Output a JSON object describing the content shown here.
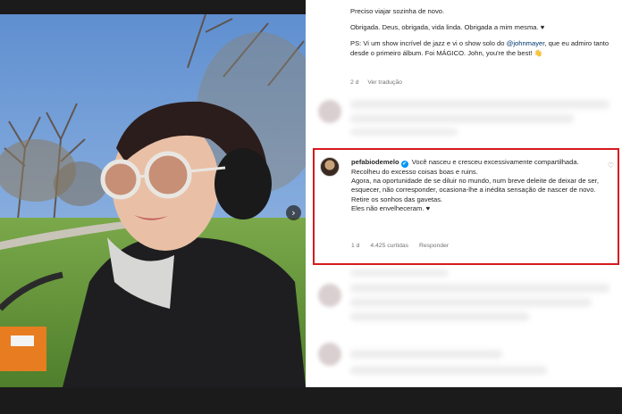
{
  "caption": {
    "line1": "Preciso viajar sozinha de novo.",
    "line2": "Obrigada. Deus, obrigada, vida linda. Obrigada a mim mesma. ♥",
    "line3_prefix": "PS: Vi um show incrível de jazz e vi o show solo do ",
    "mention": "@johnmayer",
    "line3_suffix": ", que eu admiro tanto desde o primeiro álbum. Foi MÁGICO. John, you're the best! 👋"
  },
  "caption_meta": {
    "age": "2 d",
    "translate": "Ver tradução"
  },
  "highlighted_comment": {
    "username": "pefabiodemelo",
    "verified_mark": "✔",
    "text_line1": "Você nasceu e cresceu excessivamente compartilhada.",
    "text_line2": "Recolheu do excesso coisas boas e ruins.",
    "text_line3": "Agora, na oportunidade de se diluir no mundo, num breve deleite de deixar de ser, esquecer, não corresponder, ocasiona-lhe a inédita sensação de nascer de novo.",
    "text_line4": "Retire os sonhos das gavetas.",
    "text_line5": "Eles não envelheceram. ♥",
    "age": "1 d",
    "likes": "4.425 curtidas",
    "reply": "Responder",
    "like_icon": "♡"
  },
  "photo": {
    "next_arrow": "›"
  },
  "colors": {
    "highlight_border": "#d51a1f",
    "verified_blue": "#0095f6",
    "mention": "#00376b",
    "meta_gray": "#737373"
  }
}
